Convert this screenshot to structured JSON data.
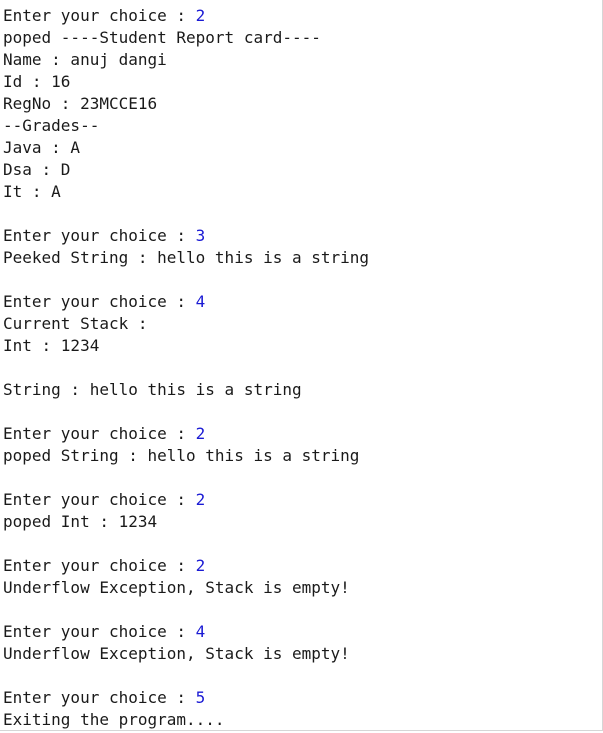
{
  "console": {
    "lines": [
      {
        "type": "prompt",
        "text": "Enter your choice : ",
        "input": "2"
      },
      {
        "type": "output",
        "text": "poped ----Student Report card----"
      },
      {
        "type": "output",
        "text": "Name : anuj dangi"
      },
      {
        "type": "output",
        "text": "Id : 16"
      },
      {
        "type": "output",
        "text": "RegNo : 23MCCE16"
      },
      {
        "type": "output",
        "text": "--Grades--"
      },
      {
        "type": "output",
        "text": "Java : A"
      },
      {
        "type": "output",
        "text": "Dsa : D"
      },
      {
        "type": "output",
        "text": "It : A"
      },
      {
        "type": "blank",
        "text": ""
      },
      {
        "type": "prompt",
        "text": "Enter your choice : ",
        "input": "3"
      },
      {
        "type": "output",
        "text": "Peeked String : hello this is a string"
      },
      {
        "type": "blank",
        "text": ""
      },
      {
        "type": "prompt",
        "text": "Enter your choice : ",
        "input": "4"
      },
      {
        "type": "output",
        "text": "Current Stack :"
      },
      {
        "type": "output",
        "text": "Int : 1234"
      },
      {
        "type": "blank",
        "text": ""
      },
      {
        "type": "output",
        "text": "String : hello this is a string"
      },
      {
        "type": "blank",
        "text": ""
      },
      {
        "type": "prompt",
        "text": "Enter your choice : ",
        "input": "2"
      },
      {
        "type": "output",
        "text": "poped String : hello this is a string"
      },
      {
        "type": "blank",
        "text": ""
      },
      {
        "type": "prompt",
        "text": "Enter your choice : ",
        "input": "2"
      },
      {
        "type": "output",
        "text": "poped Int : 1234"
      },
      {
        "type": "blank",
        "text": ""
      },
      {
        "type": "prompt",
        "text": "Enter your choice : ",
        "input": "2"
      },
      {
        "type": "output",
        "text": "Underflow Exception, Stack is empty!"
      },
      {
        "type": "blank",
        "text": ""
      },
      {
        "type": "prompt",
        "text": "Enter your choice : ",
        "input": "4"
      },
      {
        "type": "output",
        "text": "Underflow Exception, Stack is empty!"
      },
      {
        "type": "blank",
        "text": ""
      },
      {
        "type": "prompt",
        "text": "Enter your choice : ",
        "input": "5"
      },
      {
        "type": "output",
        "text": "Exiting the program...."
      }
    ]
  },
  "colors": {
    "text": "#1a1a1a",
    "input": "#1a1ad4",
    "background": "#ffffff"
  }
}
